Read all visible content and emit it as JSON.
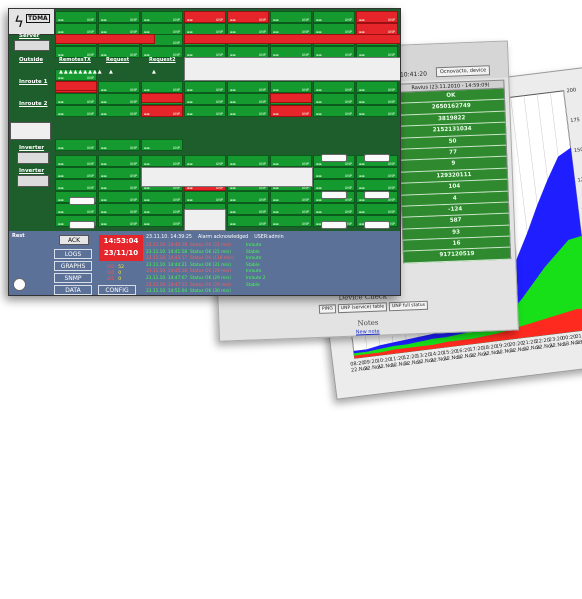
{
  "main_window": {
    "app_name": "TDMA",
    "labels": {
      "server": "Server",
      "outside": "Outside",
      "remotes_tx": "RemotesTX",
      "request": "Request",
      "request2": "Request2",
      "inroute1": "Inroute 1",
      "inroute2": "Inroute 2",
      "inverter1": "Inverter",
      "inverter2": "Inverter"
    },
    "cell_label": "UNP",
    "bottom": {
      "rest_label": "Rest",
      "ack_button": "ACK",
      "logs_button": "LOGS",
      "graphs_button": "GRAPHS",
      "snmp_button": "SNMP",
      "data_button": "DATA",
      "config_button": "CONFIG",
      "clock_time": "14:53:04",
      "clock_date": "23/11/10",
      "stats": [
        {
          "a": "0/0",
          "b": "52"
        },
        {
          "a": "0/0",
          "b": "0"
        },
        {
          "a": "0/1",
          "b": "0"
        }
      ],
      "alarm_header": {
        "time": "23.11.10. 14:39:25",
        "message": "Alarm acknowledged",
        "user": "USER:admin"
      },
      "alarms": [
        {
          "time": "23.11.10. 14:40:18",
          "message": "Status OK (22 min)",
          "status": "Inroute"
        },
        {
          "time": "23.11.10. 14:41:58",
          "message": "Status OK (22 min)",
          "status": "Stable"
        },
        {
          "time": "23.11.10. 14:43:17",
          "message": "Status OK (118 min)",
          "status": "Inroute"
        },
        {
          "time": "23.11.10. 14:44:21",
          "message": "Status OK (31 min)",
          "status": "Stable"
        },
        {
          "time": "23.11.10. 14:45:18",
          "message": "Status OK (29 min)",
          "status": "Inroute"
        },
        {
          "time": "23.11.10. 14:47:07",
          "message": "Status OK (29 min)",
          "status": "Inroute 2"
        },
        {
          "time": "23.11.10. 14:47:12",
          "message": "Status OK (29 min)",
          "status": "Stable"
        },
        {
          "time": "23.11.10. 14:51:04",
          "message": "Status OK (30 min)",
          "status": ""
        }
      ]
    }
  },
  "device_window": {
    "time": "10:41:20",
    "button": "Ocnovacto, device",
    "table_header": "Ravius (23.11.2010 - 14:59:09)",
    "values": [
      "OK",
      "2650162749",
      "3819822",
      "2152131034",
      "50",
      "77",
      "9",
      "129320111",
      "104",
      "4",
      "-124",
      "587",
      "93",
      "16",
      "917120519"
    ],
    "section_title": "Device Check",
    "buttons": [
      "PING",
      "UNP (service) table",
      "UNP full status"
    ],
    "notes_title": "Notes",
    "new_note_link": "New note"
  },
  "chart_window": {
    "chart_data": {
      "type": "area",
      "x": [
        "08:20 22.Nov",
        "09:20 22.Nov",
        "10:20 22.Nov",
        "11:20 22.Nov",
        "12:20 22.Nov",
        "13:20 22.Nov",
        "14:20 22.Nov",
        "15:20 22.Nov",
        "16:20 22.Nov",
        "17:20 22.Nov",
        "18:20 22.Nov",
        "19:20 22.Nov",
        "20:20 22.Nov",
        "21:20 22.Nov",
        "22:20 22.Nov",
        "23:20 22.Nov",
        "00:20 23.Nov",
        "01:20 23.Nov",
        "02:20 23.Nov"
      ],
      "y_tick_labels": [
        "200",
        "175",
        "150",
        "125",
        "100",
        "75",
        "50",
        "25"
      ],
      "series": [
        {
          "color": "#ff2a1f",
          "values": [
            2,
            2,
            2,
            3,
            3,
            3,
            3,
            4,
            4,
            4,
            5,
            6,
            8,
            10,
            12,
            14,
            16,
            18,
            17
          ]
        },
        {
          "color": "#18e018",
          "values": [
            4,
            4,
            5,
            6,
            6,
            7,
            8,
            8,
            9,
            10,
            12,
            16,
            22,
            32,
            44,
            56,
            66,
            76,
            78
          ]
        },
        {
          "color": "#1e1eff",
          "values": [
            6,
            6,
            8,
            9,
            10,
            11,
            12,
            14,
            16,
            20,
            26,
            36,
            48,
            66,
            86,
            108,
            128,
            146,
            152
          ]
        }
      ],
      "ylim": [
        0,
        200
      ],
      "grid": true
    }
  }
}
